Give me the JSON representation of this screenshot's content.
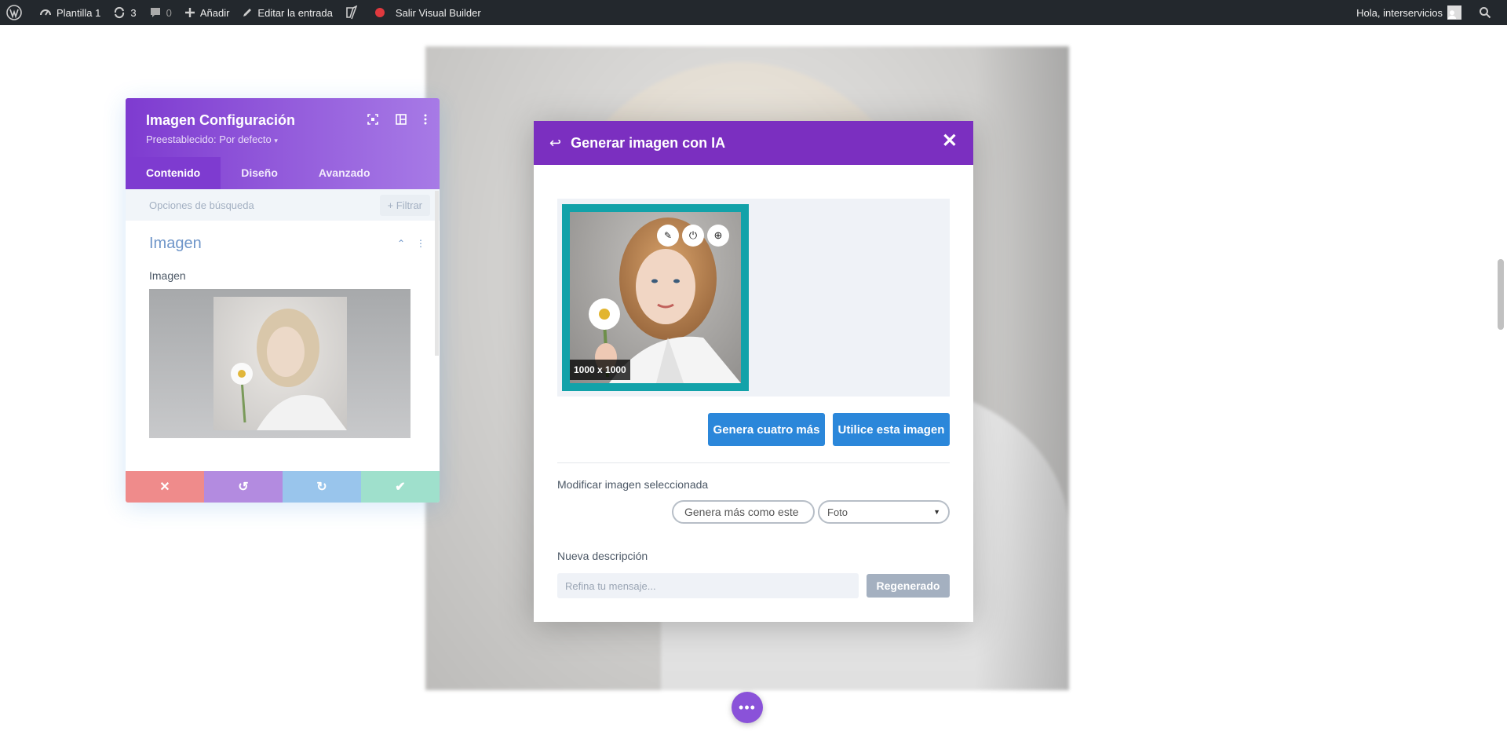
{
  "adminbar": {
    "site_name": "Plantilla 1",
    "updates_count": "3",
    "comments_count": "0",
    "add_label": "Añadir",
    "edit_label": "Editar la entrada",
    "exit_builder_label": "Salir Visual Builder",
    "greeting": "Hola, interservicios"
  },
  "settings_panel": {
    "title": "Imagen Configuración",
    "preset": "Preestablecido: Por defecto",
    "tabs": [
      "Contenido",
      "Diseño",
      "Avanzado"
    ],
    "active_tab": "Contenido",
    "search_placeholder": "Opciones de búsqueda",
    "filter_label": "+ Filtrar",
    "section_title": "Imagen",
    "image_field_label": "Imagen",
    "action_colors": {
      "cancel": "#ef8b8b",
      "undo": "#b38be0",
      "redo": "#99c5ec",
      "save": "#9fe0cc"
    }
  },
  "modal": {
    "title": "Generar imagen con IA",
    "image_dimensions": "1000 x 1000",
    "btn_generate_four": "Genera cuatro más",
    "btn_use_image": "Utilice esta imagen",
    "modify_label": "Modificar imagen seleccionada",
    "more_like_this": "Genera más como este",
    "style_select_value": "Foto",
    "new_description_label": "Nueva descripción",
    "prompt_placeholder": "Refina tu mensaje...",
    "regenerate_label": "Regenerado"
  },
  "colors": {
    "brand_purple": "#7b2fc0",
    "accent_blue": "#2b87da",
    "teal_selection": "#12a2a9"
  }
}
